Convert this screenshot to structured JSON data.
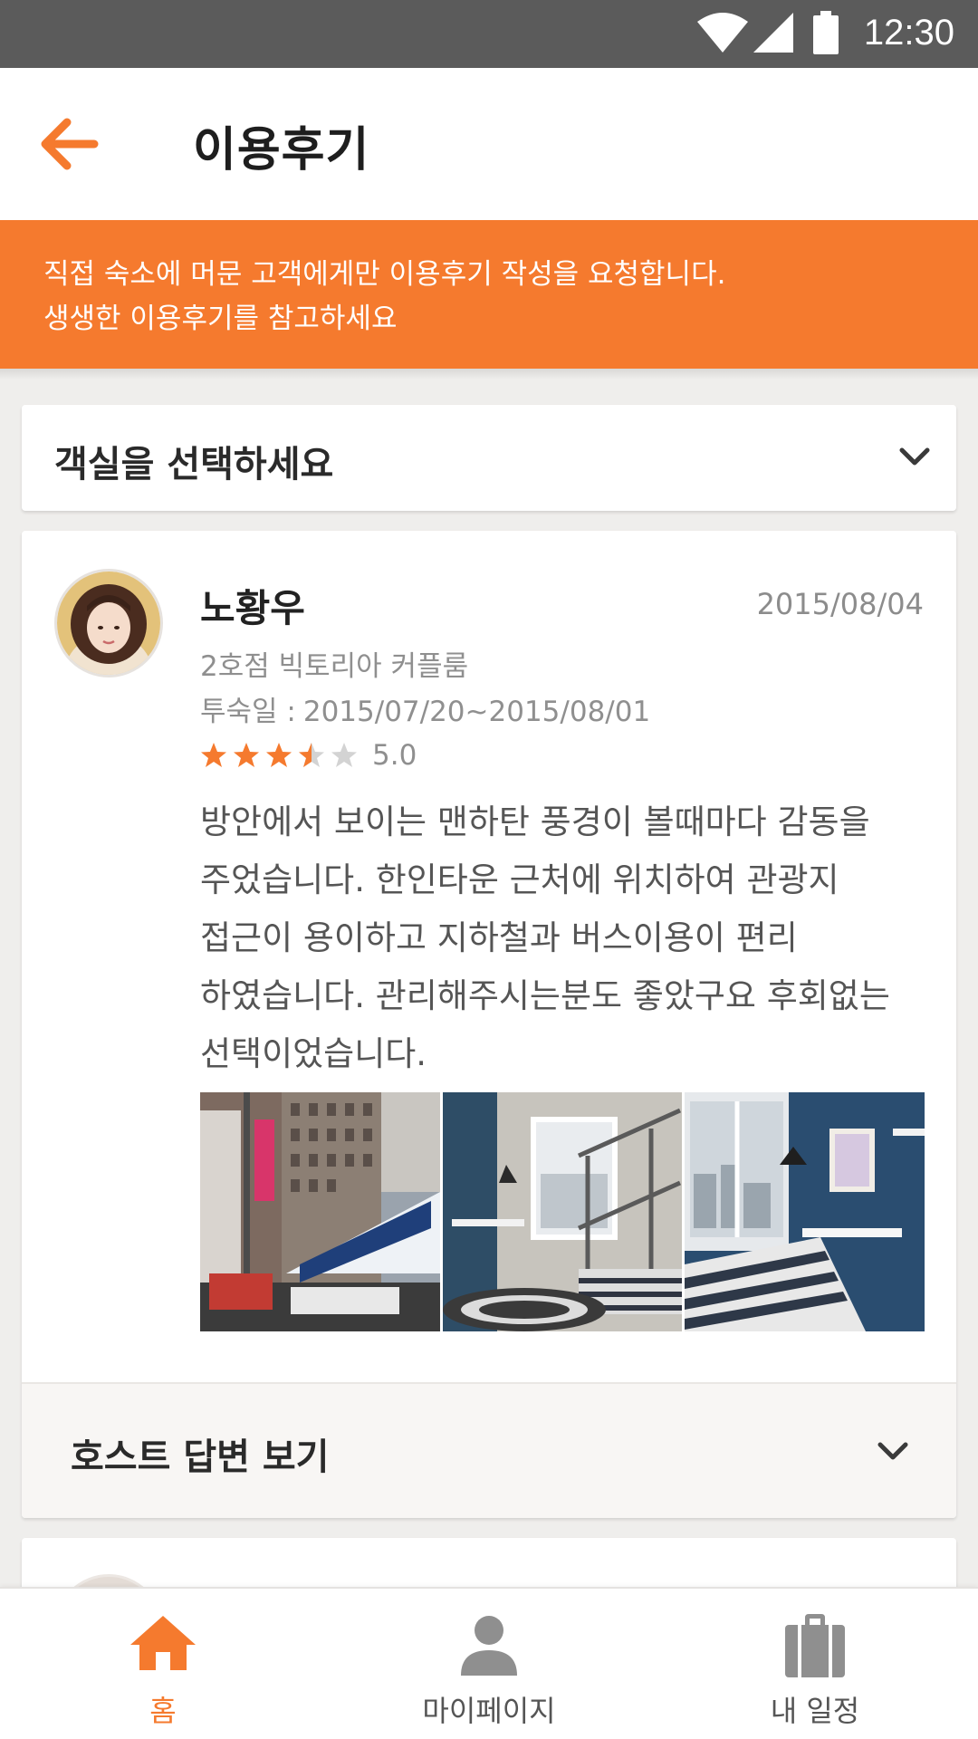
{
  "status_bar": {
    "time": "12:30"
  },
  "header": {
    "title": "이용후기"
  },
  "notice": {
    "line1": "직접 숙소에 머문 고객에게만 이용후기 작성을 요청합니다.",
    "line2": "생생한 이용후기를 참고하세요"
  },
  "room_select": {
    "label": "객실을 선택하세요"
  },
  "review": {
    "author": "노황우",
    "date": "2015/08/04",
    "room": "2호점 빅토리아 커플룸",
    "stay_label": "투숙일 :",
    "stay_period": "2015/07/20~2015/08/01",
    "rating_stars": 3.5,
    "rating_score": "5.0",
    "body_lines": [
      "방안에서 보이는 맨하탄 풍경이 볼때마다 감동을",
      "주었습니다. 한인타운 근처에 위치하여 관광지",
      "접근이 용이하고 지하철과 버스이용이 편리",
      "하였습니다. 관리해주시는분도 좋았구요 후회없는",
      "선택이었습니다."
    ],
    "photos": [
      "times-square-photo",
      "bunk-bed-room-photo",
      "bedroom-window-photo"
    ],
    "host_reply_label": "호스트 답변 보기"
  },
  "bottom_nav": {
    "items": [
      {
        "label": "홈",
        "icon": "home-icon",
        "active": true
      },
      {
        "label": "마이페이지",
        "icon": "person-icon",
        "active": false
      },
      {
        "label": "내 일정",
        "icon": "luggage-icon",
        "active": false
      }
    ]
  },
  "colors": {
    "accent": "#f57a2e",
    "text_muted": "#8f8f8f",
    "star_active": "#f57a2e",
    "star_inactive": "#d3d3d3"
  }
}
